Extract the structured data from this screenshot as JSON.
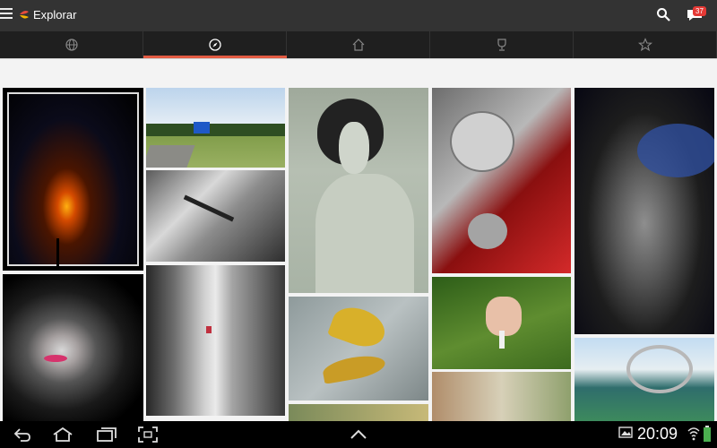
{
  "app": {
    "title": "Explorar"
  },
  "notifications": {
    "count": "37"
  },
  "tabs": [
    {
      "icon": "globe-icon",
      "active": false
    },
    {
      "icon": "compass-icon",
      "active": true
    },
    {
      "icon": "home-icon",
      "active": false
    },
    {
      "icon": "trophy-icon",
      "active": false
    },
    {
      "icon": "star-icon",
      "active": false
    }
  ],
  "photos": [
    {
      "subject": "sunset-silhouette"
    },
    {
      "subject": "road-sign-field"
    },
    {
      "subject": "lizard-on-wood"
    },
    {
      "subject": "painted-woman"
    },
    {
      "subject": "red-mirrored-lamps"
    },
    {
      "subject": "man-face-swirl"
    },
    {
      "subject": "woman-portrait-dark"
    },
    {
      "subject": "narrow-alley"
    },
    {
      "subject": "yellow-leaves-water"
    },
    {
      "subject": "honeysuckle-flower"
    },
    {
      "subject": "bridge-spiral"
    },
    {
      "subject": "flowers-partial"
    }
  ],
  "status_bar": {
    "time": "20:09"
  }
}
